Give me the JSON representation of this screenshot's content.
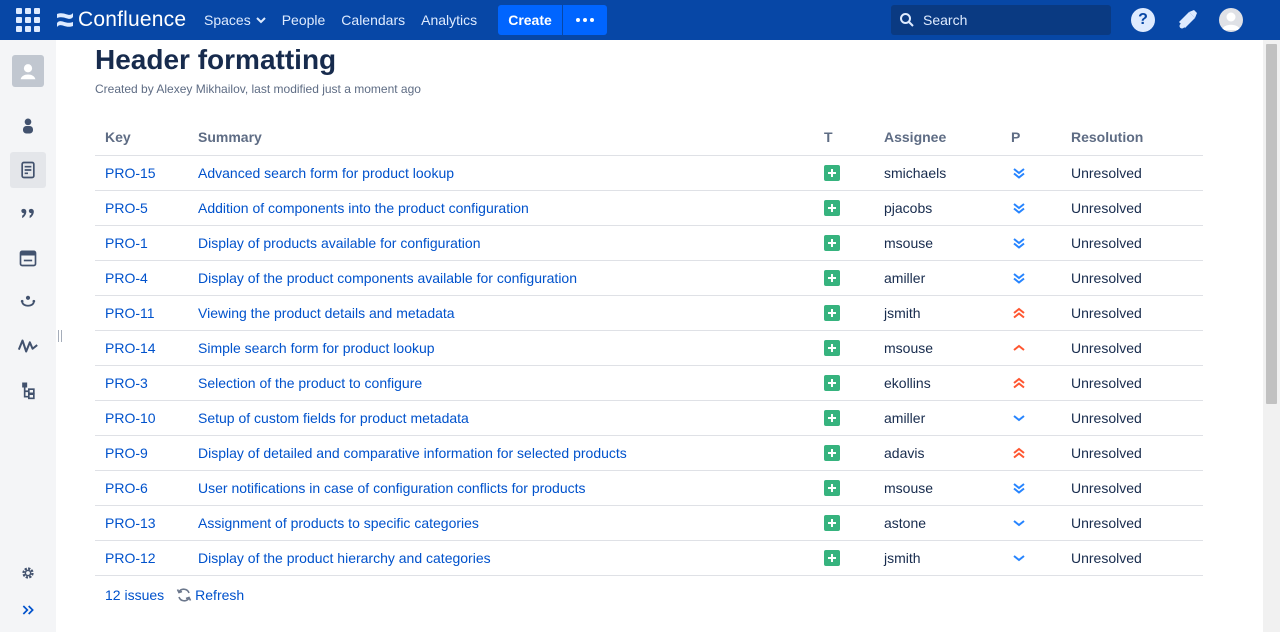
{
  "topnav": {
    "logo_text": "Confluence",
    "items": [
      {
        "label": "Spaces",
        "has_dropdown": true
      },
      {
        "label": "People"
      },
      {
        "label": "Calendars"
      },
      {
        "label": "Analytics"
      }
    ],
    "create_label": "Create",
    "search_placeholder": "Search",
    "help_label": "?"
  },
  "colors": {
    "nav_bg": "#0747a6",
    "create_bg": "#0065ff",
    "link": "#0052cc",
    "type_story": "#36b37e",
    "priority_low": "#2684ff",
    "priority_high": "#ff5630"
  },
  "page": {
    "title": "Header formatting",
    "meta_prefix": "Created by Alexey Mikhailov, last modified ",
    "meta_link": "just a moment ago"
  },
  "table": {
    "headers": {
      "key": "Key",
      "summary": "Summary",
      "type": "T",
      "assignee": "Assignee",
      "priority": "P",
      "resolution": "Resolution"
    },
    "rows": [
      {
        "key": "PRO-15",
        "summary": "Advanced search form for product lookup",
        "type": "new-feature-icon",
        "assignee": "smichaels",
        "priority": "lowest",
        "resolution": "Unresolved"
      },
      {
        "key": "PRO-5",
        "summary": "Addition of components into the product configuration",
        "type": "new-feature-icon",
        "assignee": "pjacobs",
        "priority": "lowest",
        "resolution": "Unresolved"
      },
      {
        "key": "PRO-1",
        "summary": "Display of products available for configuration",
        "type": "new-feature-icon",
        "assignee": "msouse",
        "priority": "lowest",
        "resolution": "Unresolved"
      },
      {
        "key": "PRO-4",
        "summary": "Display of the product components available for configuration",
        "type": "new-feature-icon",
        "assignee": "amiller",
        "priority": "lowest",
        "resolution": "Unresolved"
      },
      {
        "key": "PRO-11",
        "summary": "Viewing the product details and metadata",
        "type": "new-feature-icon",
        "assignee": "jsmith",
        "priority": "highest",
        "resolution": "Unresolved"
      },
      {
        "key": "PRO-14",
        "summary": "Simple search form for product lookup",
        "type": "new-feature-icon",
        "assignee": "msouse",
        "priority": "high",
        "resolution": "Unresolved"
      },
      {
        "key": "PRO-3",
        "summary": "Selection of the product to configure",
        "type": "new-feature-icon",
        "assignee": "ekollins",
        "priority": "highest",
        "resolution": "Unresolved"
      },
      {
        "key": "PRO-10",
        "summary": "Setup of custom fields for product metadata",
        "type": "new-feature-icon",
        "assignee": "amiller",
        "priority": "low",
        "resolution": "Unresolved"
      },
      {
        "key": "PRO-9",
        "summary": "Display of detailed and comparative information for selected products",
        "type": "new-feature-icon",
        "assignee": "adavis",
        "priority": "highest",
        "resolution": "Unresolved"
      },
      {
        "key": "PRO-6",
        "summary": "User notifications in case of configuration conflicts for products",
        "type": "new-feature-icon",
        "assignee": "msouse",
        "priority": "lowest",
        "resolution": "Unresolved"
      },
      {
        "key": "PRO-13",
        "summary": "Assignment of products to specific categories",
        "type": "new-feature-icon",
        "assignee": "astone",
        "priority": "low",
        "resolution": "Unresolved"
      },
      {
        "key": "PRO-12",
        "summary": "Display of the product hierarchy and categories",
        "type": "new-feature-icon",
        "assignee": "jsmith",
        "priority": "low",
        "resolution": "Unresolved"
      }
    ]
  },
  "footer": {
    "issues_count": "12 issues",
    "refresh_label": "Refresh"
  },
  "sidebar": {
    "items": [
      {
        "name": "space-avatar-icon"
      },
      {
        "name": "people-icon"
      },
      {
        "name": "pages-icon",
        "active": true
      },
      {
        "name": "blog-quote-icon"
      },
      {
        "name": "calendar-icon"
      },
      {
        "name": "questions-icon"
      },
      {
        "name": "analytics-icon"
      },
      {
        "name": "hierarchy-icon"
      },
      {
        "name": "settings-icon"
      },
      {
        "name": "expand-sidebar-icon"
      }
    ]
  }
}
